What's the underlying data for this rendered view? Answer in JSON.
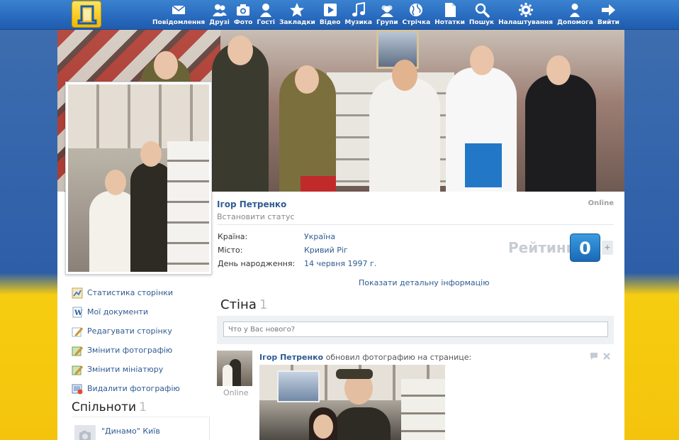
{
  "nav": {
    "items": [
      {
        "label": "Повідомлення",
        "icon": "envelope-icon"
      },
      {
        "label": "Друзі",
        "icon": "friends-icon"
      },
      {
        "label": "Фото",
        "icon": "camera-icon"
      },
      {
        "label": "Гості",
        "icon": "user-icon"
      },
      {
        "label": "Закладки",
        "icon": "star-icon"
      },
      {
        "label": "Відео",
        "icon": "play-icon"
      },
      {
        "label": "Музика",
        "icon": "music-note-icon"
      },
      {
        "label": "Групи",
        "icon": "group-icon"
      },
      {
        "label": "Стрічка",
        "icon": "globe-icon"
      },
      {
        "label": "Нотатки",
        "icon": "document-icon"
      },
      {
        "label": "Пошук",
        "icon": "magnifier-icon"
      },
      {
        "label": "Налаштування",
        "icon": "gear-icon"
      },
      {
        "label": "Допомога",
        "icon": "help-person-icon"
      },
      {
        "label": "Вийти",
        "icon": "arrow-right-icon"
      }
    ]
  },
  "profile": {
    "name": "Ігор Петренко",
    "status_placeholder": "Встановити статус",
    "online": "Online",
    "fields": [
      {
        "label": "Країна:",
        "value": "Україна"
      },
      {
        "label": "Місто:",
        "value": "Кривий Ріг"
      },
      {
        "label": "День народження:",
        "value": "14 червня 1997 г."
      }
    ],
    "rating_label": "Рейтинг",
    "rating_value": "0",
    "rating_plus": "+",
    "details_link": "Показати детальну інформацію"
  },
  "left_menu": [
    {
      "label": "Статистика сторінки",
      "icon": "chart-icon"
    },
    {
      "label": "Мої документи",
      "icon": "word-document-icon"
    },
    {
      "label": "Редагувати сторінку",
      "icon": "pencil-icon"
    },
    {
      "label": "Змінити фотографію",
      "icon": "edit-photo-icon"
    },
    {
      "label": "Змінити мініатюру",
      "icon": "edit-thumbnail-icon"
    },
    {
      "label": "Видалити фотографію",
      "icon": "delete-photo-icon"
    }
  ],
  "communities": {
    "title": "Спільноти",
    "count": "1",
    "items": [
      {
        "name": "\"Динамо\" Київ"
      }
    ]
  },
  "wall": {
    "title": "Стіна",
    "count": "1",
    "input_placeholder": "Что у Вас нового?",
    "post": {
      "author": "Ігор Петренко",
      "action": " обновил фотографию на странице:",
      "online": "Online"
    }
  },
  "colors": {
    "link": "#2f5b93",
    "topbar": "#2a6cc0",
    "rating_badge": "#1f7ccc"
  }
}
